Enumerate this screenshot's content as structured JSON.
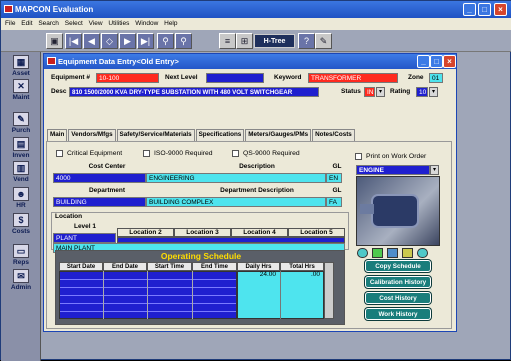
{
  "app": {
    "title": "MAPCON Evaluation"
  },
  "menu": [
    "File",
    "Edit",
    "Search",
    "Select",
    "View",
    "Utilities",
    "Window",
    "Help"
  ],
  "toolbar": {
    "htree_label": "H-Tree"
  },
  "sidebar": [
    {
      "label": "Asset",
      "icon": "asset-icon"
    },
    {
      "label": "Maint",
      "icon": "maint-icon"
    },
    {
      "label": "Purch",
      "icon": "purch-icon"
    },
    {
      "label": "Inven",
      "icon": "inven-icon"
    },
    {
      "label": "Vend",
      "icon": "vend-icon"
    },
    {
      "label": "HR",
      "icon": "hr-icon"
    },
    {
      "label": "Costs",
      "icon": "costs-icon"
    },
    {
      "label": "Reps",
      "icon": "reps-icon"
    },
    {
      "label": "Admin",
      "icon": "admin-icon"
    }
  ],
  "window": {
    "title": "Equipment Data Entry<Old Entry>"
  },
  "header": {
    "equip_label": "Equipment #",
    "equip_value": "10-100",
    "next_label": "Next Level",
    "next_value": "",
    "keyword_label": "Keyword",
    "keyword_value": "TRANSFORMER",
    "zone_label": "Zone",
    "zone_value": "01",
    "desc_label": "Desc",
    "desc_value": "810 1500/2000 KVA DRY-TYPE SUBSTATION WITH 480 VOLT SWITCHGEAR",
    "status_label": "Status",
    "status_value": "IN",
    "rating_label": "Rating",
    "rating_value": "10"
  },
  "tabs": [
    "Main",
    "Vendors/Mfgs",
    "Safety/Service/Materials",
    "Specifications",
    "Meters/Gauges/PMs",
    "Notes/Costs"
  ],
  "checks": {
    "critical": "Critical Equipment",
    "iso": "ISO-9000 Required",
    "qs": "QS-9000 Required",
    "print": "Print on Work Order"
  },
  "cost_center": {
    "h1": "Cost Center",
    "h2": "Description",
    "h3": "GL",
    "code": "4000",
    "desc": "ENGINEERING",
    "gl": "EN"
  },
  "department": {
    "h1": "Department",
    "h2": "Department Description",
    "h3": "GL",
    "code": "BUILDING",
    "desc": "BUILDING COMPLEX",
    "gl": "FA"
  },
  "location": {
    "title": "Location",
    "level1": "Level 1",
    "l2": "Location 2",
    "l3": "Location 3",
    "l4": "Location 4",
    "l5": "Location 5",
    "value": "PLANT",
    "fullname": "MAIN PLANT"
  },
  "image_select": "ENGINE",
  "schedule": {
    "title": "Operating Schedule",
    "cols": [
      "Start Date",
      "End Date",
      "Start Time",
      "End Time",
      "Daily Hrs",
      "Total Hrs"
    ],
    "daily": "24.00",
    "total": ".00"
  },
  "buttons": {
    "copy": "Copy Schedule",
    "calib": "Calibration History",
    "cost": "Cost History",
    "work": "Work History"
  },
  "colors": {
    "accent": "#1f52c3",
    "field_red": "#ff2a1f",
    "field_navy": "#1f1fcf",
    "field_cyan": "#4ee4ee",
    "button_teal": "#197d7b"
  }
}
